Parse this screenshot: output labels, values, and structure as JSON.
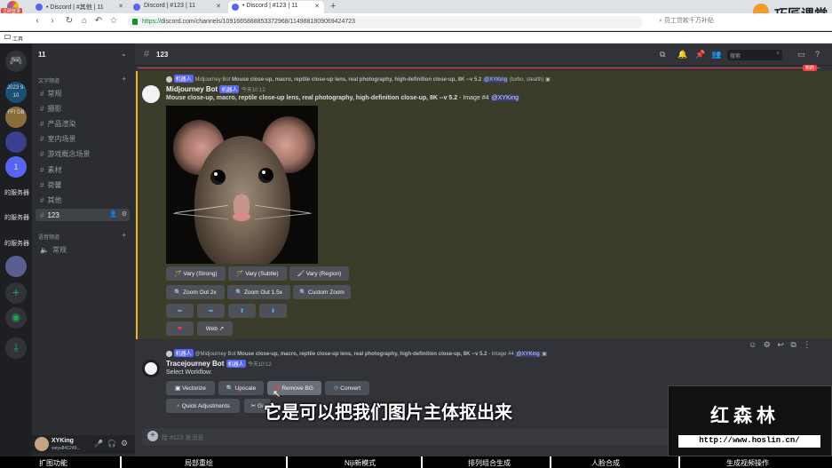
{
  "browser": {
    "tabs": [
      {
        "title": "• Discord | #其他 | 11"
      },
      {
        "title": "Discord | #123 | 11"
      },
      {
        "title": "• Discord | #123 | 11"
      }
    ],
    "new_tab": "+",
    "url_scheme": "https://",
    "url_rest": "discord.com/channels/1091665888853372968/1149881809069424723",
    "promo": "员工贷款千万补贴",
    "bookmark": "工具",
    "corner_badge": "立即登录"
  },
  "logo": {
    "text": "巧匠课堂"
  },
  "servers": [
    {
      "label": "2023 9-10"
    },
    {
      "label": "FFI DB"
    },
    {
      "label": ""
    },
    {
      "label": "1"
    },
    {
      "label": "的服务器"
    },
    {
      "label": "的服务器"
    },
    {
      "label": "的服务器"
    },
    {
      "label": ""
    }
  ],
  "sidebar": {
    "server_name": "11",
    "text_category": "文字频道",
    "text_channels": [
      "常规",
      "摄影",
      "产品渲染",
      "室内场景",
      "游戏概念场景",
      "素材",
      "荷馨",
      "其他",
      "123"
    ],
    "voice_category": "语音频道",
    "voice_channels": [
      "常规"
    ]
  },
  "user": {
    "name": "XYKing",
    "tag": "xieyu841249..."
  },
  "channel": {
    "name": "123",
    "search_placeholder": "搜索",
    "new_badge": "新的"
  },
  "message1": {
    "reply_badge": "机器人",
    "reply_user": "Midjourney Bot",
    "reply_text": "Mouse close-up, macro, reptile close-up lens, real photography, high-definition close-up, 8K --v 5.2",
    "reply_mention": "@XYKing",
    "reply_suffix": "(turbo, stealth)",
    "author": "Midjourney Bot",
    "badge": "机器人",
    "time": "今天10:12",
    "content": "Mouse close-up, macro, reptile close-up lens, real photography, high-definition close-up, 8K --v 5.2",
    "content_suffix": "- Image #4",
    "mention": "@XYKing",
    "buttons_row1": [
      "Vary (Strong)",
      "Vary (Subtle)",
      "Vary (Region)"
    ],
    "buttons_row2": [
      "Zoom Out 2x",
      "Zoom Out 1.5x",
      "Custom Zoom"
    ],
    "arrows": [
      "⬅",
      "➡",
      "⬆",
      "⬇"
    ],
    "heart": "❤",
    "web_button": "Web"
  },
  "message2": {
    "reply_badge": "机器人",
    "reply_user": "@Midjourney Bot",
    "reply_text": "Mouse close-up, macro, reptile close-up lens, real photography, high-definition close-up, 8K --v 5.2",
    "reply_suffix": "- Image #4",
    "reply_mention": "@XYKing",
    "author": "Tracejourney Bot",
    "badge": "机器人",
    "time": "今天10:12",
    "content": "Select Workflow:",
    "buttons_row1": [
      "Vectorize",
      "Upscale",
      "Remove BG",
      "Convert"
    ],
    "buttons_row2": [
      "Quick Adjustments",
      "Gr"
    ]
  },
  "input": {
    "placeholder": "给 #123 发消息"
  },
  "subtitle": "它是可以把我们图片主体抠出来",
  "watermark": {
    "name": "红森林",
    "url": "http://www.hoslin.cn/"
  },
  "bottom_bar": [
    "扩图功能",
    "局部重绘",
    "Niji新模式",
    "排列组合生成",
    "人脸合成",
    "生成视频操作"
  ]
}
